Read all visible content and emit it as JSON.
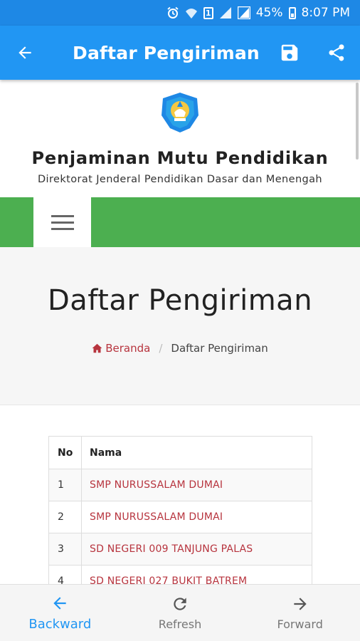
{
  "status_bar": {
    "battery_percent": "45%",
    "time": "8:07 PM",
    "sim_label": "1",
    "icons": [
      "alarm-icon",
      "wifi-icon",
      "sim-icon",
      "signal-icon",
      "signal-icon",
      "battery-icon"
    ]
  },
  "app_bar": {
    "title": "Daftar Pengiriman",
    "back_icon": "arrow-back-icon",
    "actions": [
      "save-icon",
      "share-icon"
    ],
    "color": "#2196f3"
  },
  "site": {
    "title": "Penjaminan Mutu Pendidikan",
    "subtitle": "Direktorat Jenderal Pendidikan Dasar dan Menengah",
    "nav_color": "#4caf50"
  },
  "hero": {
    "title": "Daftar Pengiriman",
    "breadcrumb": {
      "home": "Beranda",
      "separator": "/",
      "current": "Daftar Pengiriman"
    }
  },
  "table": {
    "headers": [
      "No",
      "Nama"
    ],
    "rows": [
      {
        "no": "1",
        "nama": "SMP NURUSSALAM DUMAI"
      },
      {
        "no": "2",
        "nama": "SMP NURUSSALAM DUMAI"
      },
      {
        "no": "3",
        "nama": "SD NEGERI 009 TANJUNG PALAS"
      },
      {
        "no": "4",
        "nama": "SD NEGERI 027 BUKIT BATREM"
      }
    ],
    "link_color": "#b7343e"
  },
  "bottom_nav": {
    "backward": "Backward",
    "refresh": "Refresh",
    "forward": "Forward",
    "active": "Backward"
  }
}
